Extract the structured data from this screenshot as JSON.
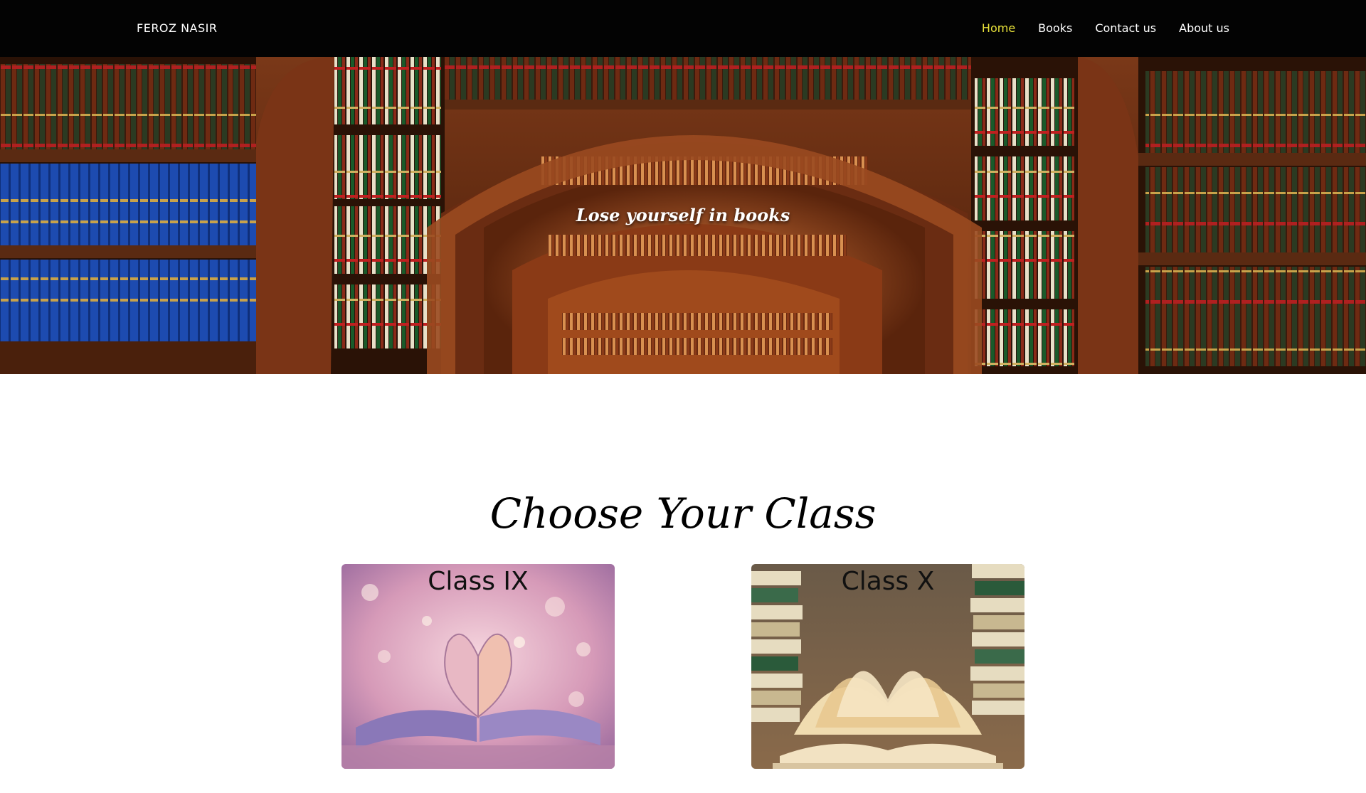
{
  "navbar": {
    "brand": "FEROZ NASIR",
    "links": [
      {
        "label": "Home",
        "active": true
      },
      {
        "label": "Books",
        "active": false
      },
      {
        "label": "Contact us",
        "active": false
      },
      {
        "label": "About us",
        "active": false
      }
    ],
    "active_color": "#e8e23a"
  },
  "hero": {
    "tagline": "Lose yourself in books"
  },
  "section": {
    "title": "Choose Your Class",
    "cards": [
      {
        "label": "Class IX"
      },
      {
        "label": "Class X"
      }
    ]
  }
}
